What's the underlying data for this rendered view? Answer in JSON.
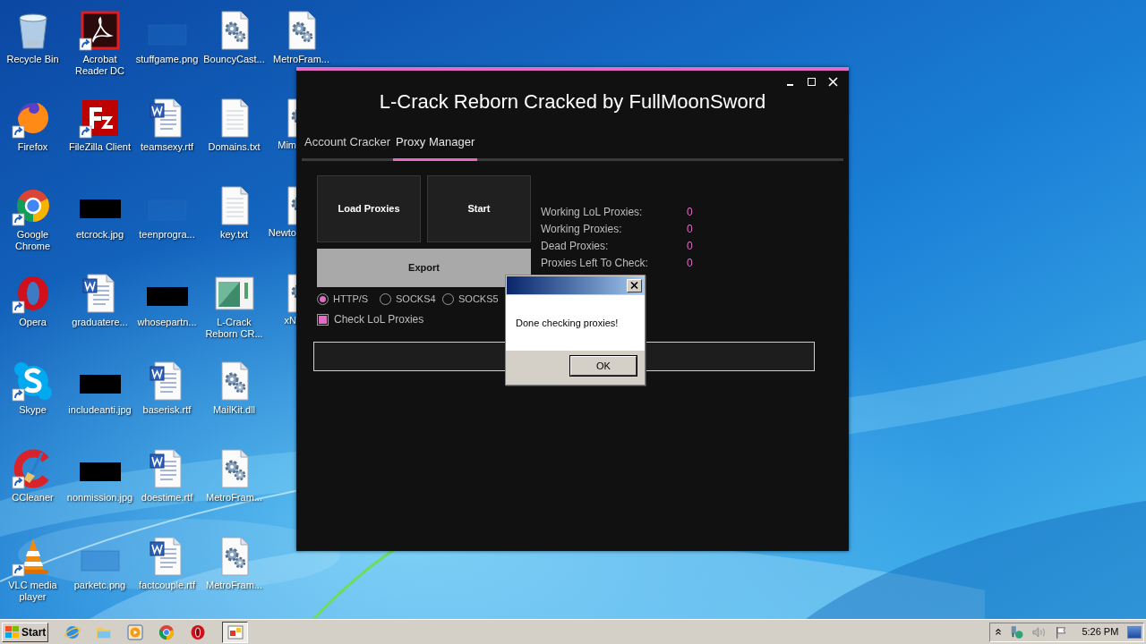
{
  "desktop": {
    "icons": [
      {
        "label": "Recycle Bin",
        "kind": "recycle",
        "shortcut": false,
        "cut": false
      },
      {
        "label": "Firefox",
        "kind": "firefox",
        "shortcut": true,
        "cut": false
      },
      {
        "label": "Google\nChrome",
        "kind": "chrome",
        "shortcut": true,
        "cut": false
      },
      {
        "label": "Opera",
        "kind": "opera",
        "shortcut": true,
        "cut": false
      },
      {
        "label": "Skype",
        "kind": "skype",
        "shortcut": true,
        "cut": false
      },
      {
        "label": "CCleaner",
        "kind": "ccleaner",
        "shortcut": true,
        "cut": false
      },
      {
        "label": "VLC media\nplayer",
        "kind": "vlc",
        "shortcut": true,
        "cut": false
      },
      {
        "label": "Acrobat\nReader DC",
        "kind": "acrobat",
        "shortcut": true,
        "cut": false
      },
      {
        "label": "FileZilla Client",
        "kind": "filezilla",
        "shortcut": true,
        "cut": false
      },
      {
        "label": "etcrock.jpg",
        "kind": "image-dark",
        "shortcut": false,
        "cut": false
      },
      {
        "label": "graduatere...",
        "kind": "word",
        "shortcut": false,
        "cut": false
      },
      {
        "label": "includeanti.jpg",
        "kind": "image-dark",
        "shortcut": false,
        "cut": false
      },
      {
        "label": "nonmission.jpg",
        "kind": "image-dark",
        "shortcut": false,
        "cut": false
      },
      {
        "label": "parketc.png",
        "kind": "image-blank",
        "shortcut": false,
        "cut": false
      },
      {
        "label": "stuffgame.png",
        "kind": "image-blank",
        "shortcut": false,
        "cut": false
      },
      {
        "label": "teamsexy.rtf",
        "kind": "word",
        "shortcut": false,
        "cut": false
      },
      {
        "label": "teenprogra...",
        "kind": "image-blank",
        "shortcut": false,
        "cut": false
      },
      {
        "label": "whosepartn...",
        "kind": "image-dark",
        "shortcut": false,
        "cut": false
      },
      {
        "label": "baserisk.rtf",
        "kind": "word",
        "shortcut": false,
        "cut": false
      },
      {
        "label": "doestime.rtf",
        "kind": "word",
        "shortcut": false,
        "cut": false
      },
      {
        "label": "factcouple.rtf",
        "kind": "word",
        "shortcut": false,
        "cut": false
      },
      {
        "label": "BouncyCast...",
        "kind": "config",
        "shortcut": false,
        "cut": false
      },
      {
        "label": "Domains.txt",
        "kind": "text",
        "shortcut": false,
        "cut": false
      },
      {
        "label": "key.txt",
        "kind": "text",
        "shortcut": false,
        "cut": false
      },
      {
        "label": "L-Crack\nReborn CR...",
        "kind": "app",
        "shortcut": false,
        "cut": false
      },
      {
        "label": "MailKit.dll",
        "kind": "config",
        "shortcut": false,
        "cut": false
      },
      {
        "label": "MetroFram...",
        "kind": "config",
        "shortcut": false,
        "cut": false
      },
      {
        "label": "MetroFram...",
        "kind": "config",
        "shortcut": false,
        "cut": false
      },
      {
        "label": "MetroFram...",
        "kind": "config",
        "shortcut": false,
        "cut": false
      },
      {
        "label": "Mim",
        "kind": "config",
        "shortcut": false,
        "cut": true
      },
      {
        "label": "Newto",
        "kind": "config",
        "shortcut": false,
        "cut": true
      },
      {
        "label": "xN",
        "kind": "config",
        "shortcut": false,
        "cut": true
      }
    ]
  },
  "app_window": {
    "title": "L-Crack Reborn Cracked by FullMoonSword",
    "tabs": [
      {
        "label": "Account Cracker",
        "selected": false
      },
      {
        "label": "Proxy Manager",
        "selected": true
      }
    ],
    "buttons": [
      {
        "label": "Load Proxies",
        "kind": "dark"
      },
      {
        "label": "Start",
        "kind": "dark"
      },
      {
        "label": "Export",
        "kind": "light"
      }
    ],
    "stats": [
      {
        "label": "Working LoL Proxies:",
        "value": "0"
      },
      {
        "label": "Working Proxies:",
        "value": "0"
      },
      {
        "label": "Dead Proxies:",
        "value": "0"
      },
      {
        "label": "Proxies Left To Check:",
        "value": "0"
      }
    ],
    "proxy_types": [
      {
        "label": "HTTP/S",
        "selected": true
      },
      {
        "label": "SOCKS4",
        "selected": false
      },
      {
        "label": "SOCKS5",
        "selected": false
      }
    ],
    "check_lol": {
      "label": "Check LoL Proxies",
      "checked": true
    },
    "progress": {
      "level": 0
    }
  },
  "dialog": {
    "message": "Done checking proxies!",
    "button": "OK"
  },
  "taskbar": {
    "start": "Start",
    "clock": "5:26 PM"
  }
}
